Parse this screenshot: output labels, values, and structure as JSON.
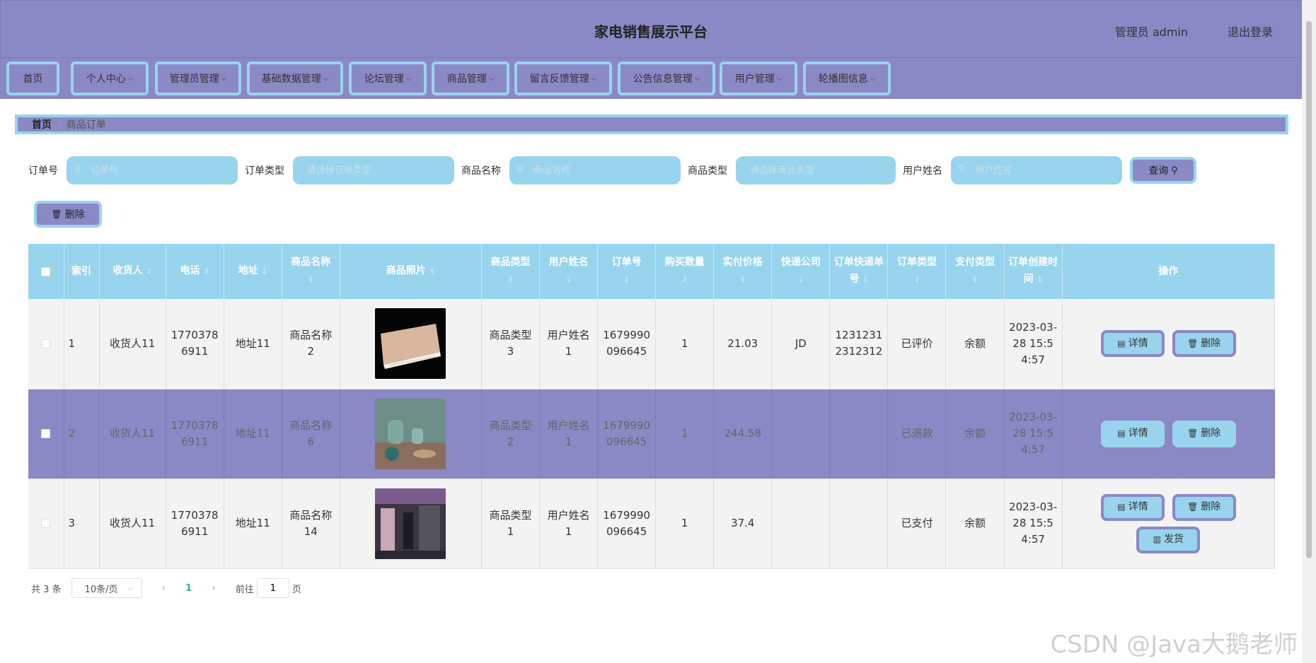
{
  "header": {
    "title": "家电销售展示平台",
    "user": "管理员 admin",
    "logout": "退出登录"
  },
  "nav": [
    {
      "label": "首页",
      "dropdown": false
    },
    {
      "label": "个人中心",
      "dropdown": true
    },
    {
      "label": "管理员管理",
      "dropdown": true
    },
    {
      "label": "基础数据管理",
      "dropdown": true
    },
    {
      "label": "论坛管理",
      "dropdown": true
    },
    {
      "label": "商品管理",
      "dropdown": true
    },
    {
      "label": "留言反馈管理",
      "dropdown": true
    },
    {
      "label": "公告信息管理",
      "dropdown": true
    },
    {
      "label": "用户管理",
      "dropdown": true
    },
    {
      "label": "轮播图信息",
      "dropdown": true
    }
  ],
  "breadcrumb": {
    "home": "首页",
    "separator": "/",
    "current": "商品订单"
  },
  "search": {
    "order_no_label": "订单号",
    "order_no_placeholder": "订单号",
    "order_type_label": "订单类型",
    "order_type_placeholder": "请选择订单类型",
    "product_name_label": "商品名称",
    "product_name_placeholder": "商品名称",
    "product_type_label": "商品类型",
    "product_type_placeholder": "请选择商品类型",
    "user_name_label": "用户姓名",
    "user_name_placeholder": "用户姓名",
    "query_label": "查询"
  },
  "delete_label": "删除",
  "table": {
    "headers": [
      "索引",
      "收货人",
      "电话",
      "地址",
      "商品名称",
      "商品照片",
      "商品类型",
      "用户姓名",
      "订单号",
      "购买数量",
      "实付价格",
      "快递公司",
      "订单快递单号",
      "订单类型",
      "支付类型",
      "订单创建时间",
      "操作"
    ],
    "rows": [
      {
        "index": "1",
        "receiver": "收货人11",
        "phone": "17703786911",
        "address": "地址11",
        "product_name": "商品名称2",
        "product_type": "商品类型3",
        "user_name": "用户姓名1",
        "order_no": "1679990096645",
        "quantity": "1",
        "price": "21.03",
        "courier": "JD",
        "tracking_no": "12312312312312",
        "order_type": "已评价",
        "pay_type": "余额",
        "created": "2023-03-28 15:54:57",
        "actions": [
          "详情",
          "删除"
        ],
        "photo": "air-conditioner"
      },
      {
        "index": "2",
        "receiver": "收货人11",
        "phone": "17703786911",
        "address": "地址11",
        "product_name": "商品名称6",
        "product_type": "商品类型2",
        "user_name": "用户姓名1",
        "order_no": "1679990096645",
        "quantity": "1",
        "price": "244.58",
        "courier": "",
        "tracking_no": "",
        "order_type": "已退款",
        "pay_type": "余额",
        "created": "2023-03-28 15:54:57",
        "actions": [
          "详情",
          "删除"
        ],
        "photo": "kettle-set"
      },
      {
        "index": "3",
        "receiver": "收货人11",
        "phone": "17703786911",
        "address": "地址11",
        "product_name": "商品名称14",
        "product_type": "商品类型1",
        "user_name": "用户姓名1",
        "order_no": "1679990096645",
        "quantity": "1",
        "price": "37.4",
        "courier": "",
        "tracking_no": "",
        "order_type": "已支付",
        "pay_type": "余额",
        "created": "2023-03-28 15:54:57",
        "actions": [
          "详情",
          "删除",
          "发货"
        ],
        "photo": "kitchen-appliances"
      }
    ]
  },
  "pagination": {
    "total": "共 3 条",
    "page_size": "10条/页",
    "current_page": "1",
    "goto_label": "前往",
    "goto_value": "1",
    "page_suffix": "页"
  },
  "watermark": "CSDN @Java大鹅老师",
  "colors": {
    "primary": "#8a89c5",
    "accent": "#98d4ed",
    "active_page": "#2bb48c"
  }
}
